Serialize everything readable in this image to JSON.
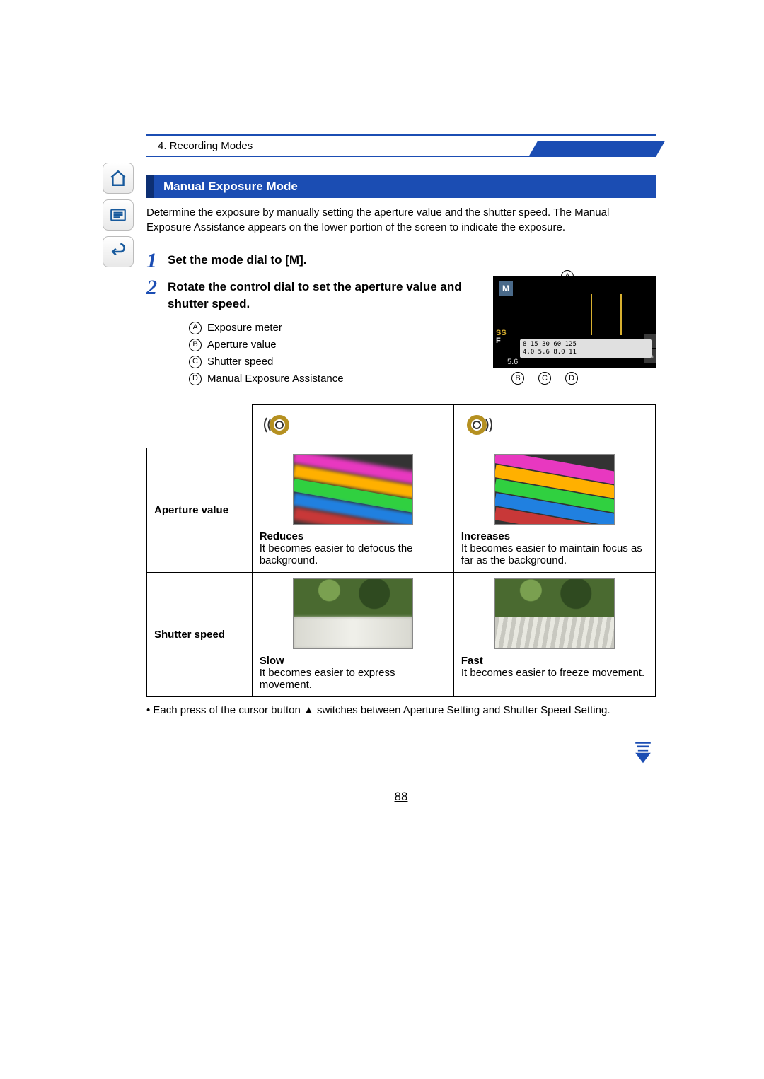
{
  "breadcrumb": "4. Recording Modes",
  "section_title": "Manual Exposure Mode",
  "intro": "Determine the exposure by manually setting the aperture value and the shutter speed. The Manual Exposure Assistance appears on the lower portion of the screen to indicate the exposure.",
  "steps": {
    "s1_num": "1",
    "s1_text_pre": "Set the mode dial to [",
    "s1_mode_letter": "M",
    "s1_text_post": "].",
    "s2_num": "2",
    "s2_text": "Rotate the control dial to set the aperture value and shutter speed."
  },
  "legend": {
    "a": "Exposure meter",
    "b": "Aperture value",
    "c": "Shutter speed",
    "d": "Manual Exposure Assistance"
  },
  "callouts": {
    "a": "A",
    "b": "B",
    "c": "C",
    "d": "D"
  },
  "lcd": {
    "mode": "M",
    "ss_label": "SS",
    "f_label": "F",
    "scale_top": "8    15    30    60   125",
    "scale_bot": "4.0   5.6   8.0   11",
    "aperture_val": "5.6",
    "right1": "‹",
    "right2": "Fn"
  },
  "table": {
    "row1_label": "Aperture value",
    "row2_label": "Shutter speed",
    "col1": {
      "ap_title": "Reduces",
      "ap_desc": "It becomes easier to defocus the background.",
      "sh_title": "Slow",
      "sh_desc": "It becomes easier to express movement."
    },
    "col2": {
      "ap_title": "Increases",
      "ap_desc": "It becomes easier to maintain focus as far as the background.",
      "sh_title": "Fast",
      "sh_desc": "It becomes easier to freeze movement."
    }
  },
  "note": "• Each press of the cursor button ▲ switches between Aperture Setting and Shutter Speed Setting.",
  "page_number": "88"
}
